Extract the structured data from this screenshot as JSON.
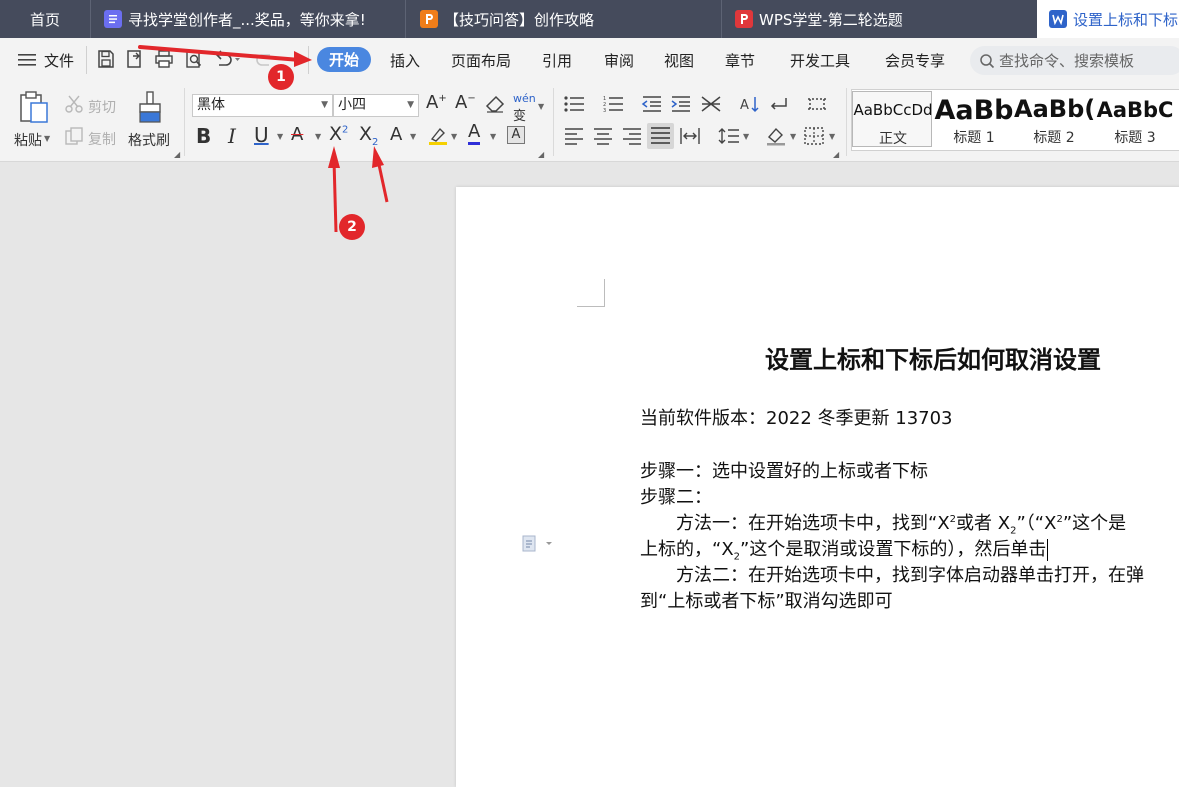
{
  "tabs": {
    "home": "首页",
    "doc1": "寻找学堂创作者_...奖品，等你来拿!",
    "doc2": "【技巧问答】创作攻略",
    "doc3": "WPS学堂-第二轮选题",
    "doc4": "设置上标和下标"
  },
  "menu": {
    "file": "文件",
    "home": "开始",
    "insert": "插入",
    "layout": "页面布局",
    "reference": "引用",
    "review": "审阅",
    "view": "视图",
    "chapter": "章节",
    "devtools": "开发工具",
    "member": "会员专享",
    "search_placeholder": "查找命令、搜索模板"
  },
  "ribbon": {
    "paste": "粘贴",
    "cut": "剪切",
    "copy": "复制",
    "format_painter": "格式刷",
    "font_name": "黑体",
    "font_size": "小四",
    "styles": [
      {
        "sample": "AaBbCcDd",
        "label": "正文"
      },
      {
        "sample": "AaBb",
        "label": "标题 1"
      },
      {
        "sample": "AaBb(",
        "label": "标题 2"
      },
      {
        "sample": "AaBbC",
        "label": "标题 3"
      }
    ]
  },
  "document": {
    "title": "设置上标和下标后如何取消设置",
    "version": "当前软件版本：2022 冬季更新 13703",
    "step1": "步骤一：选中设置好的上标或者下标",
    "step2": "步骤二：",
    "method1_a": "方法一：在开始选项卡中，找到“X",
    "method1_b": "或者 X",
    "method1_c": "”（“X",
    "method1_d": "”这个是",
    "method1_line2_a": "上标的，“X",
    "method1_line2_b": "”这个是取消或设置下标的），然后单击",
    "method2": "方法二：在开始选项卡中，找到字体启动器单击打开，在弹",
    "method2_line2": "到“上标或者下标”取消勾选即可",
    "sup": "2",
    "sub": "2"
  },
  "annotations": {
    "badge1": "1",
    "badge2": "2",
    "color": "#e2272b"
  }
}
